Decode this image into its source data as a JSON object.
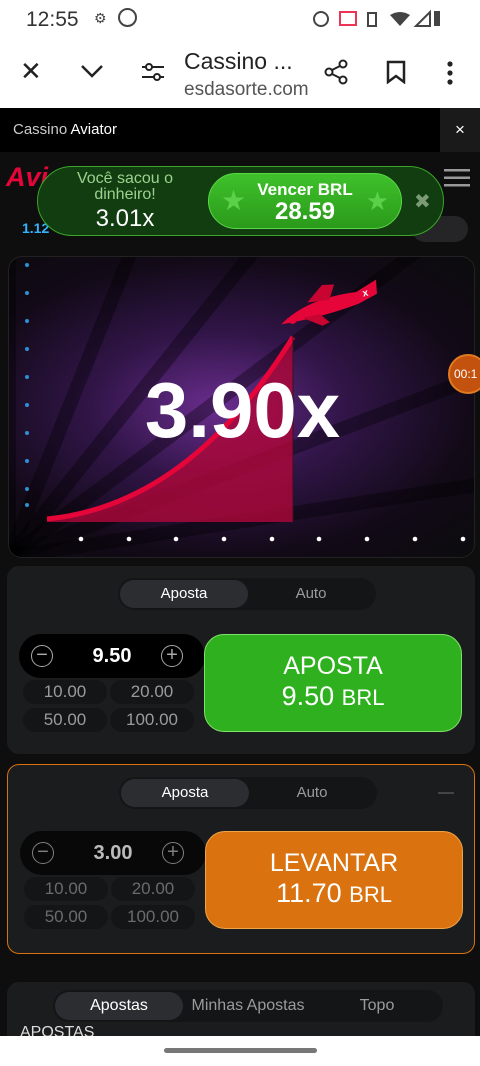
{
  "status": {
    "time": "12:55"
  },
  "browser": {
    "title": "Cassino ...",
    "url": "esdasorte.com"
  },
  "gamebar": {
    "prefix": "Cassino",
    "name": "Aviator",
    "close": "×"
  },
  "game": {
    "logo": "Avi",
    "history_first": "1.12",
    "multiplier": "3.90x",
    "timer": "00:1"
  },
  "toast": {
    "line1": "Você sacou o",
    "line2": "dinheiro!",
    "multiplier": "3.01x",
    "win_label": "Vencer BRL",
    "win_amount": "28.59",
    "close": "✖"
  },
  "bet1": {
    "tab_active": "Aposta",
    "tab_inactive": "Auto",
    "amount": "9.50",
    "chips": [
      "10.00",
      "20.00",
      "50.00",
      "100.00"
    ],
    "button_l1": "APOSTA",
    "button_amount": "9.50",
    "button_cur": "BRL"
  },
  "bet2": {
    "tab_active": "Aposta",
    "tab_inactive": "Auto",
    "amount": "3.00",
    "chips": [
      "10.00",
      "20.00",
      "50.00",
      "100.00"
    ],
    "button_l1": "LEVANTAR",
    "button_amount": "11.70",
    "button_cur": "BRL"
  },
  "bottom": {
    "tabs": [
      "Apostas",
      "Minhas Apostas",
      "Topo"
    ],
    "section": "APOSTAS"
  },
  "colors": {
    "green": "#2fb11f",
    "orange": "#d9720f",
    "red": "#e50539"
  }
}
